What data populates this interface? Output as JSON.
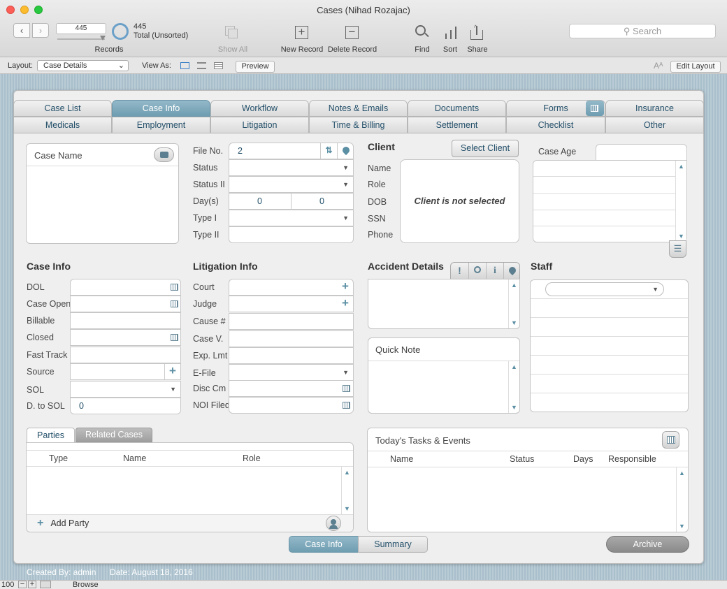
{
  "window": {
    "title": "Cases (Nihad Rozajac)"
  },
  "toolbar": {
    "records_value": "445",
    "records_label": "Records",
    "total_count": "445",
    "total_label": "Total (Unsorted)",
    "show_all": "Show All",
    "new_record": "New Record",
    "delete_record": "Delete Record",
    "find": "Find",
    "sort": "Sort",
    "share": "Share",
    "search_placeholder": "Search"
  },
  "layoutbar": {
    "layout_label": "Layout:",
    "layout_value": "Case Details",
    "view_as": "View As:",
    "preview": "Preview",
    "edit_layout": "Edit Layout"
  },
  "tabs": {
    "row1": [
      "Case List",
      "Case Info",
      "Workflow",
      "Notes & Emails",
      "Documents",
      "Forms",
      "Insurance"
    ],
    "row2": [
      "Medicals",
      "Employment",
      "Litigation",
      "Time & Billing",
      "Settlement",
      "Checklist",
      "Other"
    ],
    "active": "Case Info"
  },
  "case_name": {
    "label": "Case Name"
  },
  "file": {
    "labels": [
      "File No.",
      "Status",
      "Status II",
      "Day(s)",
      "Type I",
      "Type II"
    ],
    "file_no": "2",
    "days1": "0",
    "days2": "0"
  },
  "client": {
    "title": "Client",
    "select_button": "Select Client",
    "labels": [
      "Name",
      "Role",
      "DOB",
      "SSN",
      "Phone"
    ],
    "not_selected": "Client is not selected"
  },
  "case_age": {
    "label": "Case Age"
  },
  "case_info": {
    "title": "Case Info",
    "labels": [
      "DOL",
      "Case Open",
      "Billable",
      "Closed",
      "Fast Track",
      "Source",
      "SOL",
      "D. to SOL"
    ],
    "d_to_sol": "0"
  },
  "litigation_info": {
    "title": "Litigation Info",
    "labels": [
      "Court",
      "Judge",
      "Cause #",
      "Case V.",
      "Exp. Lmt",
      "E-File",
      "Disc Cm",
      "NOI Filed"
    ]
  },
  "accident": {
    "title": "Accident Details"
  },
  "quick_note": {
    "title": "Quick Note"
  },
  "staff": {
    "title": "Staff"
  },
  "parties": {
    "tabs": [
      "Parties",
      "Related Cases"
    ],
    "columns": [
      "Type",
      "Name",
      "Role"
    ],
    "add_party": "Add Party"
  },
  "tasks": {
    "title": "Today's Tasks & Events",
    "columns": [
      "Name",
      "Status",
      "Days",
      "Responsible"
    ]
  },
  "bottom": {
    "tabs": [
      "Case Info",
      "Summary"
    ],
    "archive": "Archive",
    "created_by": "Created By: admin",
    "date": "Date: August 18, 2016"
  },
  "statusbar": {
    "zoom": "100",
    "mode": "Browse"
  }
}
